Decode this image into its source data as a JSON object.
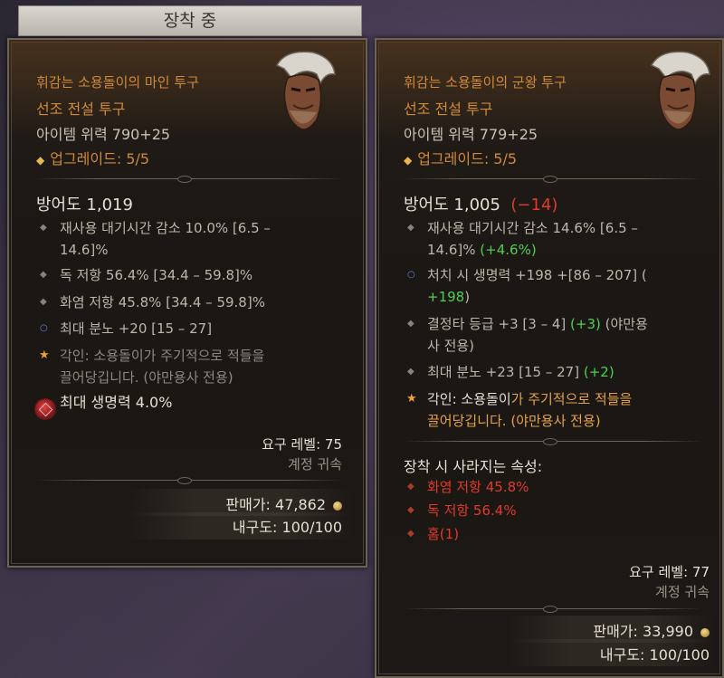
{
  "equipped_tab": "장착 중",
  "left": {
    "item_name": "휘감는 소용돌이의 마인 투구",
    "item_type": "선조 전설 투구",
    "item_power": "아이템 위력 790+25",
    "upgrade": "업그레이드: 5/5",
    "armor": "방어도 1,019",
    "affixes": [
      {
        "line1": "재사용 대기시간 감소 10.0% [6.5 –",
        "line2": "14.6]%"
      },
      {
        "line1": "독 저항 56.4% [34.4 – 59.8]%"
      },
      {
        "line1": "화염 저항 45.8% [34.4 – 59.8]%"
      },
      {
        "line1": "최대 분노 +20 [15 – 27]"
      }
    ],
    "aspect": {
      "line1": "각인: 소용돌이가 주기적으로 적들을",
      "line2": "끌어당깁니다. (야만용사 전용)"
    },
    "socket": "최대 생명력 4.0%",
    "required_level": "요구 레벨: 75",
    "account_bound": "계정 귀속",
    "sell_value": "판매가: 47,862",
    "durability": "내구도: 100/100"
  },
  "right": {
    "item_name": "휘감는 소용돌이의 군왕 투구",
    "item_type": "선조 전설 투구",
    "item_power": "아이템 위력 779+25",
    "upgrade": "업그레이드: 5/5",
    "armor": "방어도 1,005",
    "armor_diff": "(−14)",
    "affixes": [
      {
        "line1": "재사용 대기시간 감소 14.6% [6.5 –",
        "line2": "14.6]%",
        "diff": "(+4.6%)"
      },
      {
        "line1": "처치 시 생명력 +198 +[86 – 207] (",
        "diff2": "+198",
        "close": ")"
      },
      {
        "line1": "결정타 등급 +3 [3 – 4]",
        "diff": "(+3)",
        "line1b": "(야만용",
        "line2": "사 전용)"
      },
      {
        "line1": "최대 분노 +23 [15 – 27]",
        "diff": "(+2)"
      }
    ],
    "aspect": {
      "prefix": "각인: 소용돌이",
      "line1": "가 주기적으로 적들을",
      "line2": "끌어당깁니다. (야만용사 전용)"
    },
    "lost_header": "장착 시 사라지는 속성:",
    "lost": [
      "화염 저항 45.8%",
      "독 저항 56.4%",
      "홈(1)"
    ],
    "required_level": "요구 레벨: 77",
    "account_bound": "계정 귀속",
    "sell_value": "판매가: 33,990",
    "durability": "내구도: 100/100"
  },
  "colors": {
    "legendary": "#d08a3a",
    "negative": "#e03a2a",
    "positive": "#4fd14f",
    "text": "#e6dfd2"
  },
  "icons": [
    "helm-icon",
    "gem-socket-icon",
    "aspect-star-icon",
    "gold-coin-icon"
  ]
}
